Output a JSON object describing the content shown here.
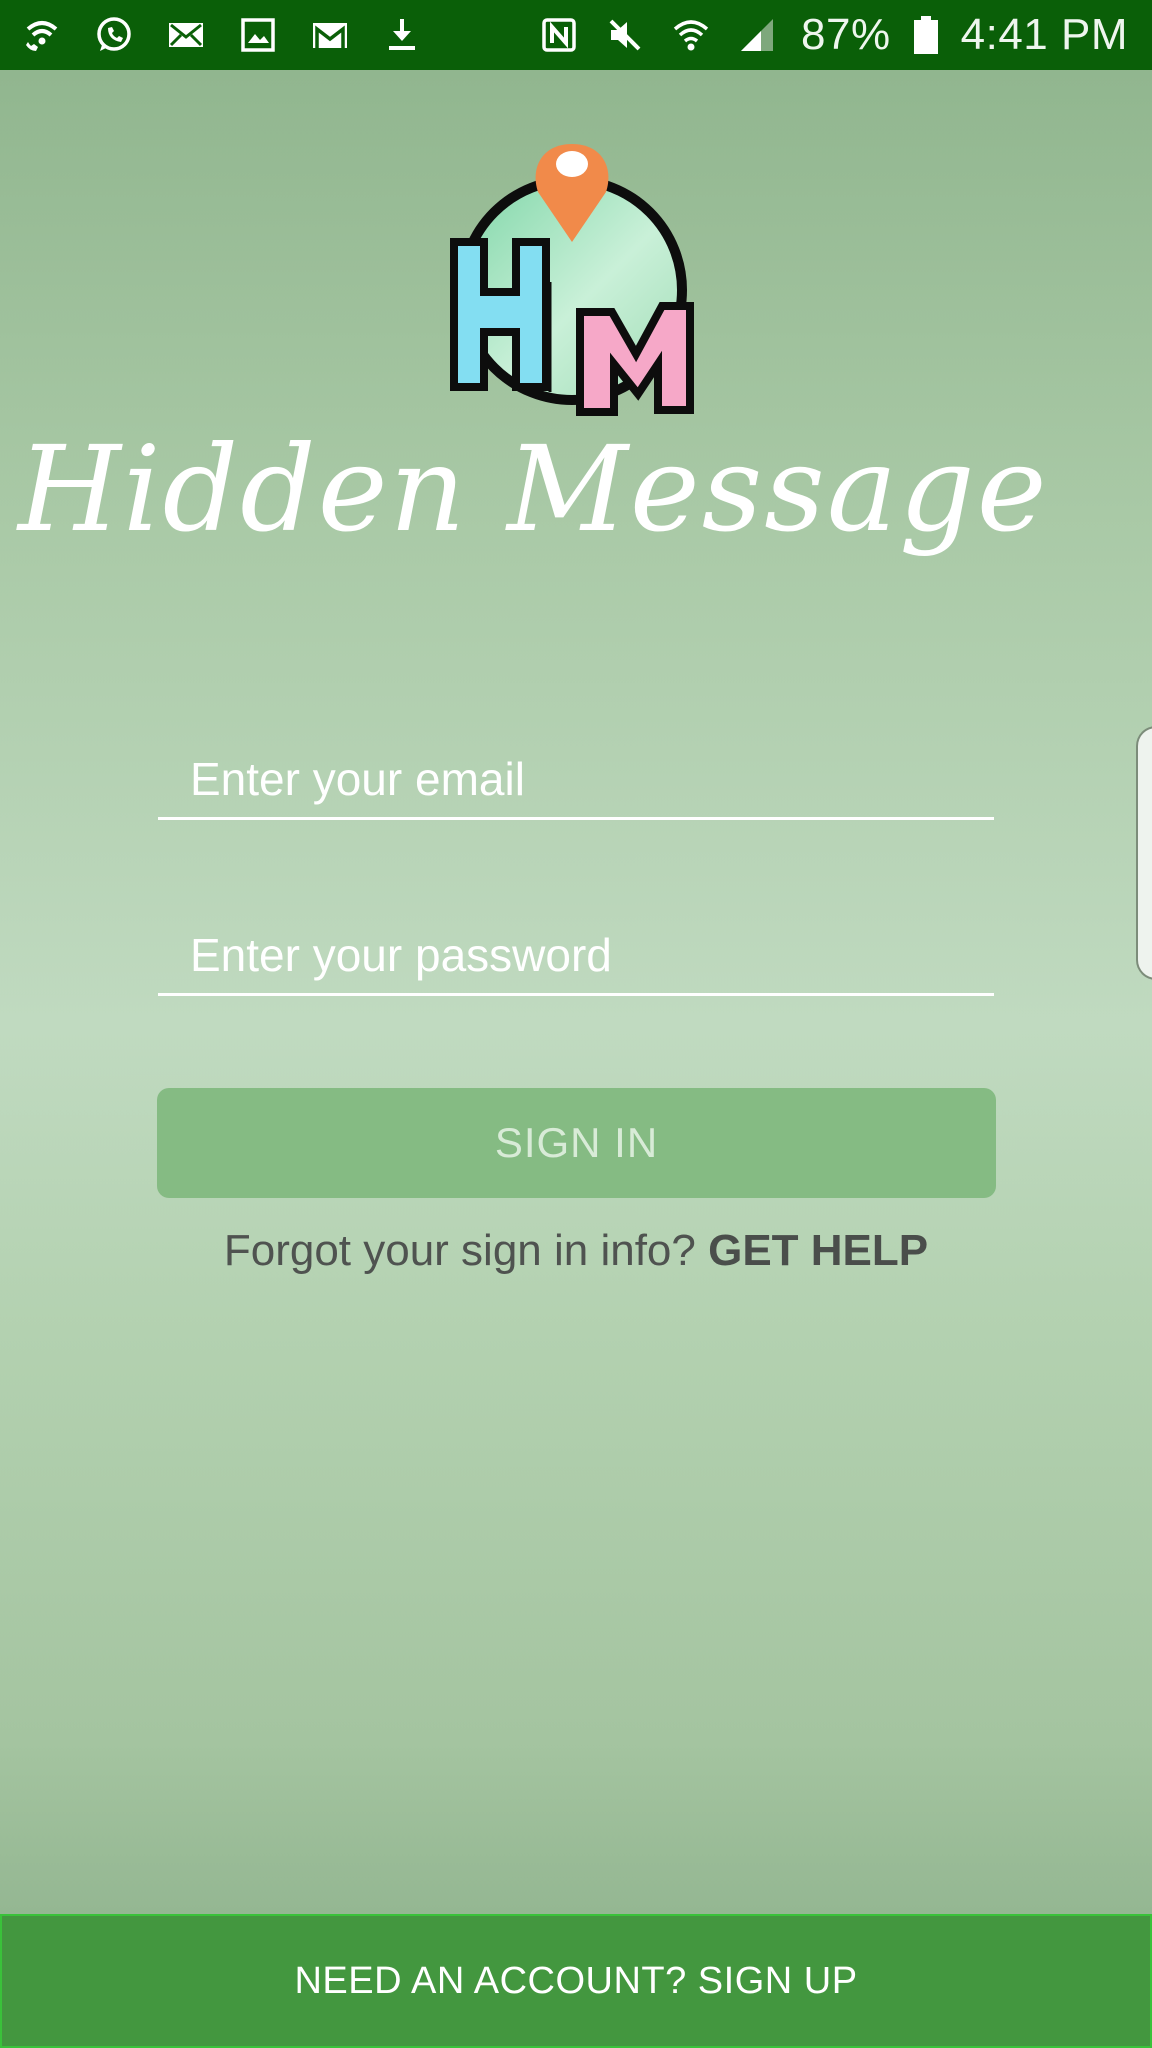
{
  "status_bar": {
    "left_icons": [
      "wifi-call-icon",
      "whatsapp-icon",
      "mail-icon",
      "image-icon",
      "gmail-icon",
      "download-icon"
    ],
    "right_icons": [
      "nfc-icon",
      "mute-icon",
      "wifi-icon",
      "signal-icon"
    ],
    "battery_text": "87%",
    "time": "4:41 PM"
  },
  "app": {
    "title": "Hidden Message",
    "logo_letters": "HM"
  },
  "form": {
    "email_placeholder": "Enter your email",
    "password_placeholder": "Enter your password",
    "signin_label": "SIGN IN",
    "help_text": "Forgot your sign in info?",
    "help_link": "GET HELP"
  },
  "footer": {
    "signup_label": "NEED AN ACCOUNT? SIGN UP"
  },
  "colors": {
    "status_bar": "#0a5f08",
    "signin_button": "#85bb83",
    "signup_bar": "#43973f"
  }
}
